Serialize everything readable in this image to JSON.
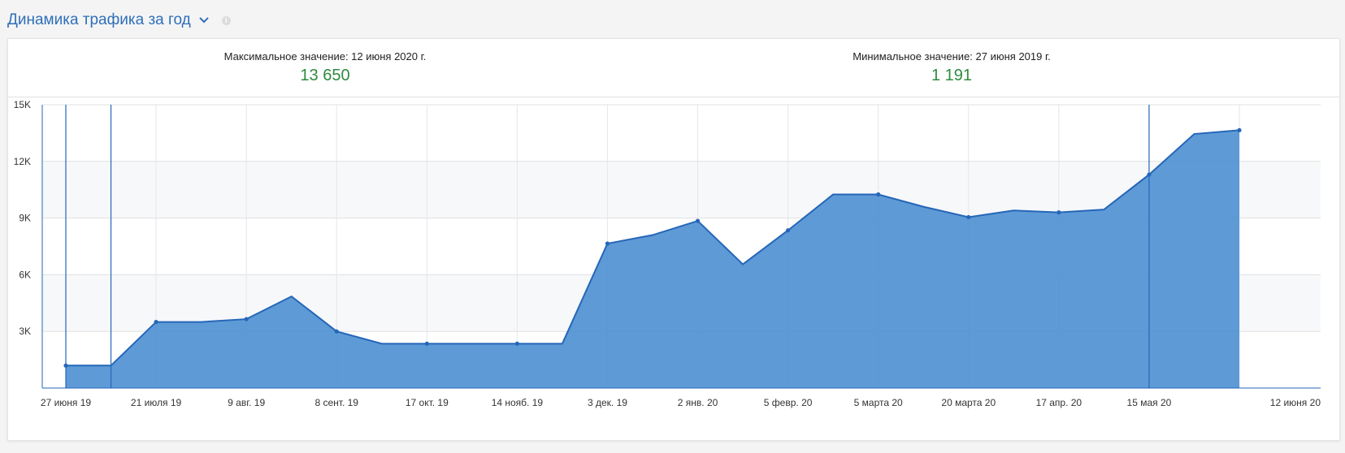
{
  "header": {
    "title": "Динамика трафика за год",
    "dropdown_icon": "chevron-down-icon",
    "info_icon": "info-icon"
  },
  "stats": {
    "max_label": "Максимальное значение: 12 июня 2020 г.",
    "max_value": "13 650",
    "min_label": "Минимальное значение: 27 июня 2019 г.",
    "min_value": "1 191"
  },
  "colors": {
    "title": "#2f6fb8",
    "accent_value": "#2e8b3e",
    "series_fill": "#4d8fd1",
    "series_line": "#2566b8"
  },
  "chart_data": {
    "type": "area",
    "title": "",
    "xlabel": "",
    "ylabel": "",
    "ylim": [
      0,
      15000
    ],
    "y_ticks": [
      3000,
      6000,
      9000,
      12000,
      15000
    ],
    "y_tick_labels": [
      "3K",
      "6K",
      "9K",
      "12K",
      "15K"
    ],
    "x_tick_labels": [
      "27 июня 19",
      "21 июля 19",
      "9 авг. 19",
      "8 сент. 19",
      "17 окт. 19",
      "14 нояб. 19",
      "3 дек. 19",
      "2 янв. 20",
      "5 февр. 20",
      "5 марта 20",
      "20 марта 20",
      "17 апр. 20",
      "15 мая 20",
      "12 июня 20"
    ],
    "grid": true,
    "series": [
      {
        "values": [
          1191,
          1191,
          3500,
          3500,
          3650,
          4850,
          3000,
          2350,
          2350,
          2350,
          2350,
          2350,
          7650,
          8100,
          8850,
          6550,
          8350,
          10250,
          10250,
          9600,
          9050,
          9400,
          9300,
          9450,
          11300,
          13450,
          13650
        ]
      }
    ],
    "markers_at": [
      0,
      2,
      4,
      6,
      8,
      10,
      12,
      14,
      16,
      18,
      20,
      22,
      24,
      26
    ],
    "highlight_lines_at": [
      0,
      1,
      24
    ]
  }
}
